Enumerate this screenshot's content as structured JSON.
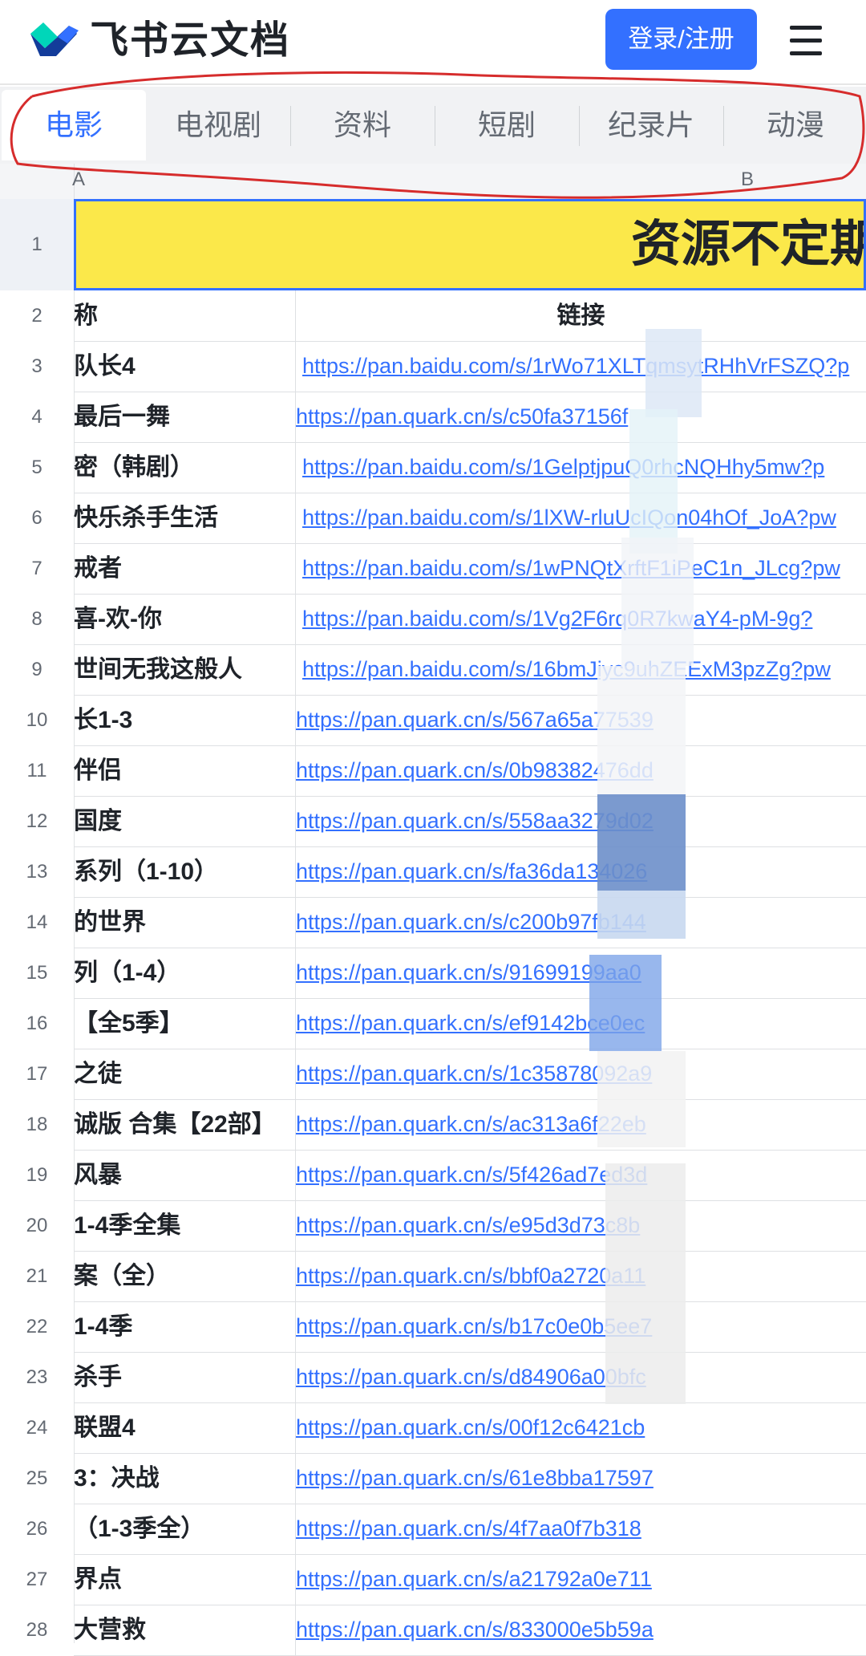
{
  "header": {
    "app_title": "飞书云文档",
    "login_label": "登录/注册",
    "brand_color": "#3370ff"
  },
  "tabs": [
    {
      "label": "电影",
      "active": true
    },
    {
      "label": "电视剧",
      "active": false
    },
    {
      "label": "资料",
      "active": false
    },
    {
      "label": "短剧",
      "active": false
    },
    {
      "label": "纪录片",
      "active": false
    },
    {
      "label": "动漫",
      "active": false
    }
  ],
  "columns": [
    "A",
    "B"
  ],
  "sheet": {
    "title": "资源不定期",
    "header_row": {
      "num": "2",
      "name": "称",
      "link": "链接"
    },
    "rows": [
      {
        "num": "3",
        "name": "队长4",
        "link": "https://pan.baidu.com/s/1rWo71XLTqmsytRHhVrFSZQ?p"
      },
      {
        "num": "4",
        "name": "最后一舞",
        "link": "https://pan.quark.cn/s/c50fa37156f"
      },
      {
        "num": "5",
        "name": "密（韩剧）",
        "link": "https://pan.baidu.com/s/1GelptjpuQ0rhcNQHhy5mw?p"
      },
      {
        "num": "6",
        "name": "快乐杀手生活",
        "link": "https://pan.baidu.com/s/1lXW-rluUcIQon04hOf_JoA?pw"
      },
      {
        "num": "7",
        "name": "戒者",
        "link": "https://pan.baidu.com/s/1wPNQtXrftF1iPeC1n_JLcg?pw"
      },
      {
        "num": "8",
        "name": "喜-欢-你",
        "link": "https://pan.baidu.com/s/1Vg2F6rq0R7kwaY4-pM-9g?"
      },
      {
        "num": "9",
        "name": "世间无我这般人",
        "link": "https://pan.baidu.com/s/16bmJiyc9uhZEExM3pzZg?pw"
      },
      {
        "num": "10",
        "name": "长1-3",
        "link": "https://pan.quark.cn/s/567a65a77539"
      },
      {
        "num": "11",
        "name": "伴侣",
        "link": "https://pan.quark.cn/s/0b98382476dd"
      },
      {
        "num": "12",
        "name": "国度",
        "link": "https://pan.quark.cn/s/558aa3279d02"
      },
      {
        "num": "13",
        "name": "系列（1-10）",
        "link": "https://pan.quark.cn/s/fa36da134026"
      },
      {
        "num": "14",
        "name": "的世界",
        "link": "https://pan.quark.cn/s/c200b97fb144"
      },
      {
        "num": "15",
        "name": "列（1-4）",
        "link": "https://pan.quark.cn/s/91699199aa0"
      },
      {
        "num": "16",
        "name": "【全5季】",
        "link": "https://pan.quark.cn/s/ef9142bce0ec"
      },
      {
        "num": "17",
        "name": "之徒",
        "link": "https://pan.quark.cn/s/1c35878092a9"
      },
      {
        "num": "18",
        "name": "诚版 合集【22部】",
        "link": "https://pan.quark.cn/s/ac313a6f22eb"
      },
      {
        "num": "19",
        "name": "风暴",
        "link": "https://pan.quark.cn/s/5f426ad7ed3d"
      },
      {
        "num": "20",
        "name": "1-4季全集",
        "link": "https://pan.quark.cn/s/e95d3d73c8b"
      },
      {
        "num": "21",
        "name": "案（全）",
        "link": "https://pan.quark.cn/s/bbf0a2720a11"
      },
      {
        "num": "22",
        "name": "1-4季",
        "link": "https://pan.quark.cn/s/b17c0e0b5ee7"
      },
      {
        "num": "23",
        "name": "杀手",
        "link": "https://pan.quark.cn/s/d84906a00bfc"
      },
      {
        "num": "24",
        "name": "联盟4",
        "link": "https://pan.quark.cn/s/00f12c6421cb"
      },
      {
        "num": "25",
        "name": "3：决战",
        "link": "https://pan.quark.cn/s/61e8bba17597"
      },
      {
        "num": "26",
        "name": "（1-3季全）",
        "link": "https://pan.quark.cn/s/4f7aa0f7b318"
      },
      {
        "num": "27",
        "name": "界点",
        "link": "https://pan.quark.cn/s/a21792a0e711"
      },
      {
        "num": "28",
        "name": "大营救",
        "link": "https://pan.quark.cn/s/833000e5b59a"
      }
    ]
  }
}
